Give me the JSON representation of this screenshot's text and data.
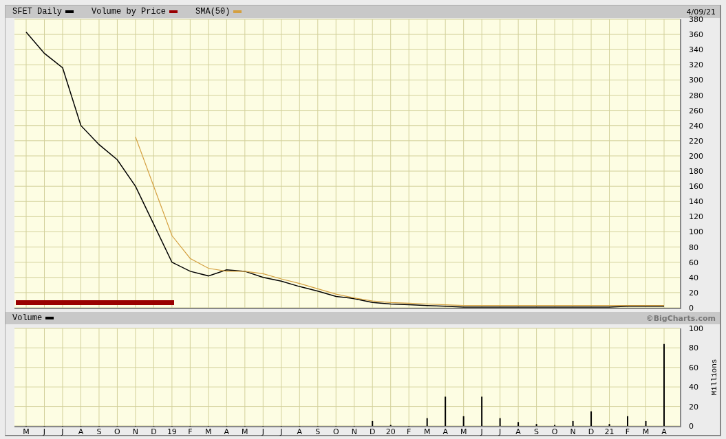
{
  "header": {
    "date": "4/09/21"
  },
  "price_chart": {
    "volume_by_price": {
      "label": "Volume by Price",
      "color": "#990000"
    },
    "chart_data": {
      "type": "line",
      "grid": true,
      "series": [
        {
          "name": "SFET Daily",
          "color": "#000000",
          "values": [
            363,
            335,
            316,
            240,
            215,
            195,
            160,
            110,
            60,
            48,
            42,
            50,
            48,
            40,
            35,
            28,
            22,
            15,
            12,
            7,
            5,
            4,
            3,
            2,
            1,
            1,
            1,
            1,
            1,
            1,
            1,
            1,
            1,
            2,
            2,
            2
          ]
        },
        {
          "name": "SMA(50)",
          "color": "#d4a040",
          "values": [
            null,
            null,
            null,
            null,
            null,
            null,
            225,
            160,
            95,
            65,
            52,
            48,
            48,
            45,
            38,
            32,
            25,
            18,
            13,
            9,
            7,
            6,
            5,
            4,
            3,
            3,
            3,
            3,
            3,
            3,
            3,
            3,
            3,
            3,
            3,
            3
          ]
        }
      ],
      "ylim": [
        0,
        380
      ],
      "yticks": [
        0,
        20,
        40,
        60,
        80,
        100,
        120,
        140,
        160,
        180,
        200,
        220,
        240,
        260,
        280,
        300,
        320,
        340,
        360,
        380
      ]
    }
  },
  "volume_chart": {
    "copyright": "©BigCharts.com",
    "chart_data": {
      "type": "bar",
      "grid": true,
      "ylabel": "Millions",
      "categories": [
        "M",
        "J",
        "J",
        "A",
        "S",
        "O",
        "N",
        "D",
        "19",
        "F",
        "M",
        "A",
        "M",
        "J",
        "J",
        "A",
        "S",
        "O",
        "N",
        "D",
        "20",
        "F",
        "M",
        "A",
        "M",
        "J",
        "J",
        "A",
        "S",
        "O",
        "N",
        "D",
        "21",
        "F",
        "M",
        "A"
      ],
      "series": [
        {
          "name": "Volume",
          "color": "#000000",
          "values": [
            0,
            0,
            0,
            0,
            0,
            0,
            0,
            0,
            0,
            0,
            0,
            0,
            0,
            0,
            0,
            0,
            0,
            0,
            0,
            5,
            1,
            0,
            8,
            30,
            10,
            30,
            8,
            4,
            2,
            1,
            5,
            15,
            2,
            10,
            5,
            84
          ]
        }
      ],
      "ylim": [
        0,
        100
      ],
      "yticks": [
        0,
        20,
        40,
        60,
        80,
        100
      ]
    }
  }
}
